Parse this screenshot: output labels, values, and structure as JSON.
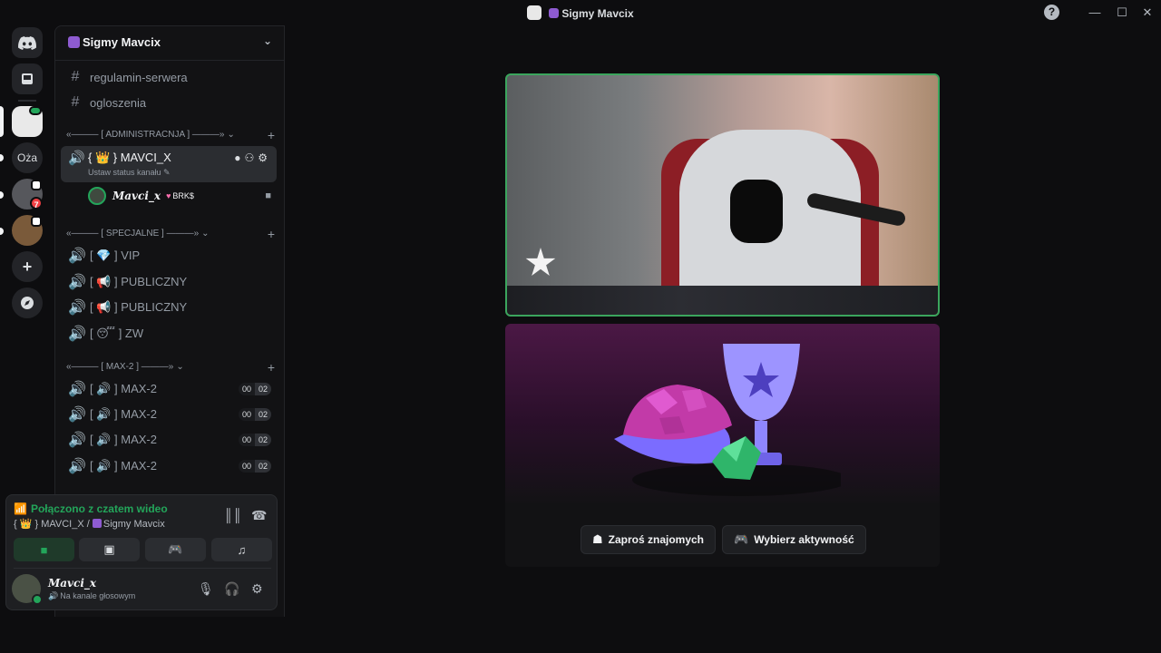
{
  "window": {
    "title": "Sigmy Mavcix",
    "minimize": "—",
    "maximize": "☐",
    "close": "✕",
    "help": "?"
  },
  "rail": {
    "items": [
      {
        "name": "discord-home",
        "icon": "discord-logo-icon"
      },
      {
        "name": "inbox",
        "icon": "inbox-icon"
      },
      {
        "name": "server-sigmy",
        "icon": "server-avatar"
      },
      {
        "name": "server-oza",
        "label": "Oża"
      },
      {
        "name": "server-3",
        "badge": "7"
      },
      {
        "name": "server-4"
      },
      {
        "name": "add-server",
        "icon": "plus-icon",
        "symbol": "+"
      },
      {
        "name": "discover",
        "icon": "compass-icon"
      }
    ]
  },
  "server": {
    "name": "Sigmy Mavcix",
    "channels_top": [
      {
        "name": "regulamin-serwera",
        "icon": "#"
      },
      {
        "name": "ogloszenia",
        "icon": "#"
      }
    ],
    "categories": {
      "admin": "«——— [ ADMINISTRACNJA ] ———»",
      "special": "«——— [ SPECJALNE ] ———»",
      "max2": "«——— [ MAX-2 ] ———»"
    },
    "active_channel": {
      "name": "{ 👑 } MAVCI_X",
      "status": "Ustaw status kanału ✎"
    },
    "voice_user": {
      "name": "Mavci_x",
      "tag": "BRK$",
      "heart": "♥"
    },
    "special_channels": [
      "[ 💎 ] VIP",
      "[ 📢 ] PUBLICZNY",
      "[ 📢 ] PUBLICZNY",
      "[ 😴 ] ZW"
    ],
    "max2_channels": [
      {
        "name": "[ 🔊 ] MAX-2",
        "users": "00",
        "limit": "02"
      },
      {
        "name": "[ 🔊 ] MAX-2",
        "users": "00",
        "limit": "02"
      },
      {
        "name": "[ 🔊 ] MAX-2",
        "users": "00",
        "limit": "02"
      },
      {
        "name": "[ 🔊 ] MAX-2",
        "users": "00",
        "limit": "02"
      }
    ]
  },
  "voice_panel": {
    "connected": "Połączono z czatem wideo",
    "location_channel": "{ 👑 } MAVCI_X / ",
    "location_server": "Sigmy Mavcix"
  },
  "user_panel": {
    "name": "Mavci_x",
    "status": "Na kanale głosowym"
  },
  "activity": {
    "invite_label": "Zaproś znajomych",
    "choose_label": "Wybierz aktywność"
  },
  "colors": {
    "accent_green": "#23a55a",
    "video_border": "#3ba55d",
    "badge_red": "#f23f43"
  }
}
